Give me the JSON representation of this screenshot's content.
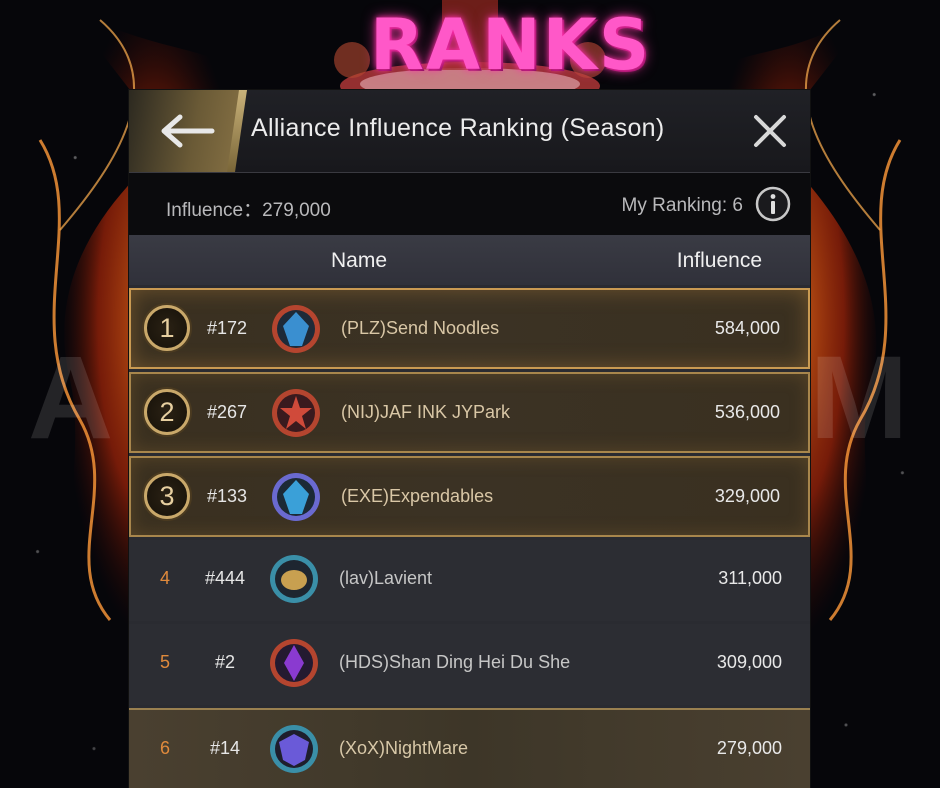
{
  "banner": {
    "title": "RANKS",
    "watermark_left": "A",
    "watermark_right": "M"
  },
  "window": {
    "title": "Alliance Influence Ranking (Season)",
    "back_icon": "arrow-left-icon",
    "close_icon": "close-icon"
  },
  "summary": {
    "influence_text": "Influence：279,000",
    "my_ranking_text": "My Ranking: 6",
    "info_icon": "info-icon"
  },
  "columns": {
    "name": "Name",
    "influence": "Influence"
  },
  "rows": [
    {
      "rank": "1",
      "server": "#172",
      "name": "(PLZ)Send Noodles",
      "influence": "584,000",
      "emblem_color": "#3a8fd0",
      "emblem_frame": "#b5452f"
    },
    {
      "rank": "2",
      "server": "#267",
      "name": "(NIJ)JAF INK JYPark",
      "influence": "536,000",
      "emblem_color": "#d04a3a",
      "emblem_frame": "#b5452f"
    },
    {
      "rank": "3",
      "server": "#133",
      "name": "(EXE)Expendables",
      "influence": "329,000",
      "emblem_color": "#3aa0d8",
      "emblem_frame": "#6a6ad0"
    },
    {
      "rank": "4",
      "server": "#444",
      "name": "(lav)Lavient",
      "influence": "311,000",
      "emblem_color": "#c8a050",
      "emblem_frame": "#3a8fa8"
    },
    {
      "rank": "5",
      "server": "#2",
      "name": "(HDS)Shan Ding Hei Du She",
      "influence": "309,000",
      "emblem_color": "#8a3ad0",
      "emblem_frame": "#b5452f"
    },
    {
      "rank": "6",
      "server": "#14",
      "name": "(XoX)NightMare",
      "influence": "279,000",
      "emblem_color": "#6a5ad8",
      "emblem_frame": "#3a8fa8"
    }
  ],
  "colors": {
    "gold_border": "#a8864c",
    "rank_number_plain": "#e08a3c",
    "banner_pink": "#ff58c8"
  }
}
